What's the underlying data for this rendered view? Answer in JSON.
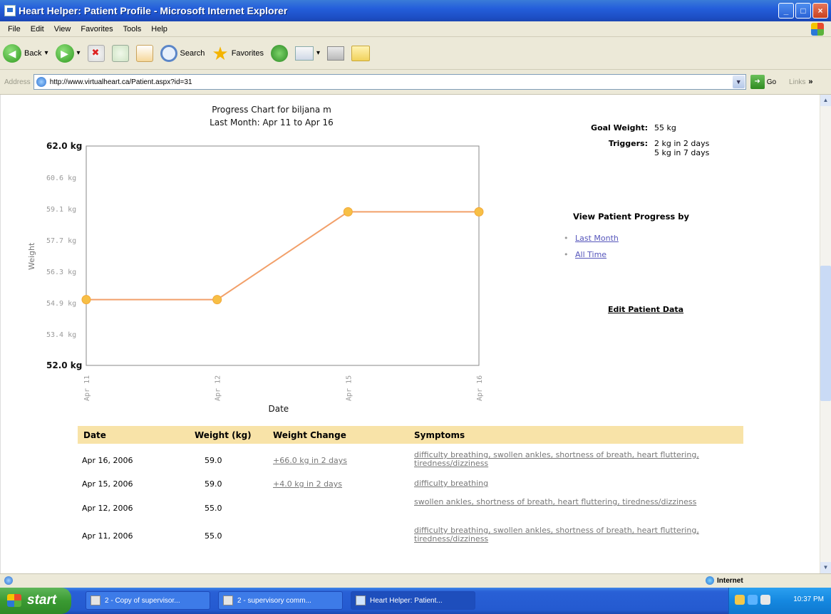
{
  "window": {
    "title": "Heart Helper: Patient Profile - Microsoft Internet Explorer",
    "buttons": [
      "_",
      "□",
      "×"
    ]
  },
  "menu": [
    "File",
    "Edit",
    "View",
    "Favorites",
    "Tools",
    "Help"
  ],
  "toolbar": {
    "back_label": "Back",
    "search_label": "Search",
    "favorites_label": "Favorites"
  },
  "address": {
    "label": "Address",
    "url": "http://www.virtualheart.ca/Patient.aspx?id=31",
    "go_label": "Go",
    "links_label": "Links"
  },
  "chart": {
    "title_line1": "Progress Chart for biljana m",
    "title_line2": "Last Month: Apr 11 to Apr 16"
  },
  "chart_data": {
    "type": "line",
    "title": "Progress Chart for biljana m",
    "subtitle": "Last Month: Apr 11 to Apr 16",
    "xlabel": "Date",
    "ylabel": "Weight",
    "categories": [
      "Apr 11",
      "Apr 12",
      "Apr 15",
      "Apr 16"
    ],
    "values": [
      55.0,
      55.0,
      59.0,
      59.0
    ],
    "yticks": [
      "62.0 kg",
      "60.6 kg",
      "59.1 kg",
      "57.7 kg",
      "56.3 kg",
      "54.9 kg",
      "53.4 kg",
      "52.0 kg"
    ],
    "ylim": [
      52.0,
      62.0
    ],
    "line_color": "#f2a06a",
    "marker_color": "#f7bf45",
    "grid": false
  },
  "goal": {
    "label": "Goal Weight:",
    "value": "55 kg"
  },
  "triggers": {
    "label": "Triggers:",
    "line1": "2 kg in 2 days",
    "line2": "5 kg in 7 days"
  },
  "progress_nav": {
    "heading": "View Patient Progress by",
    "items": [
      "Last Month",
      "All Time"
    ]
  },
  "edit_link": "Edit Patient Data",
  "table": {
    "headers": [
      "Date",
      "Weight (kg)",
      "Weight Change",
      "Symptoms"
    ],
    "rows": [
      {
        "date": "Apr 16, 2006",
        "weight": "59.0",
        "change": "+66.0 kg in 2 days",
        "symptoms": "difficulty breathing, swollen ankles, shortness of breath, heart fluttering, tiredness/dizziness"
      },
      {
        "date": "Apr 15, 2006",
        "weight": "59.0",
        "change": "+4.0 kg in 2 days",
        "symptoms": "difficulty breathing"
      },
      {
        "date": "Apr 12, 2006",
        "weight": "55.0",
        "change": "",
        "symptoms": "swollen ankles, shortness of breath, heart fluttering, tiredness/dizziness"
      },
      {
        "date": "Apr 11, 2006",
        "weight": "55.0",
        "change": "",
        "symptoms": "difficulty breathing, swollen ankles, shortness of breath, heart fluttering, tiredness/dizziness"
      }
    ]
  },
  "status": {
    "zone": "Internet"
  },
  "taskbar": {
    "start_label": "start",
    "tasks": [
      "2 - Copy of supervisor...",
      "2 - supervisory comm...",
      "Heart Helper: Patient..."
    ],
    "clock": "10:37 PM"
  }
}
